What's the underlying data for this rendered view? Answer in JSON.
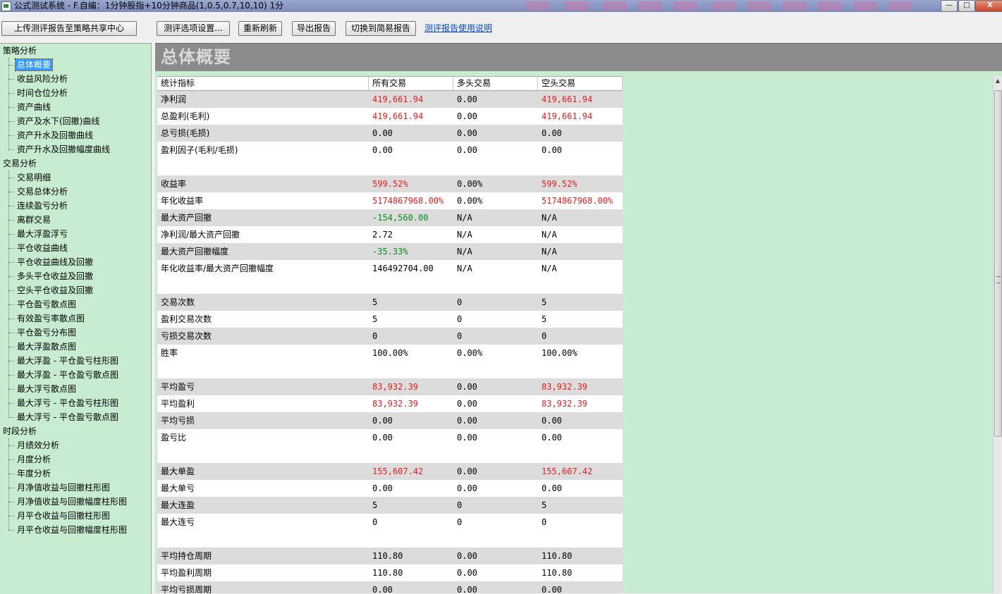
{
  "window": {
    "title": "公式测试系统 - F.自编：1分钟股指+10分钟商品(1,0.5,0.7,10,10) 1分",
    "minimize": "—",
    "maximize": "□",
    "close": "X"
  },
  "toolbar": {
    "upload": "上传测评报告至策略共享中心",
    "options": "测评选项设置...",
    "refresh": "重新刷新",
    "export": "导出报告",
    "simple": "切换到简易报告",
    "help": "测评报告使用说明"
  },
  "tree": {
    "groups": [
      {
        "label": "策略分析",
        "items": [
          "总体概要",
          "收益风险分析",
          "时间仓位分析",
          "资产曲线",
          "资产及水下(回撤)曲线",
          "资产升水及回撤曲线",
          "资产升水及回撤幅度曲线"
        ]
      },
      {
        "label": "交易分析",
        "items": [
          "交易明细",
          "交易总体分析",
          "连续盈亏分析",
          "离群交易",
          "最大浮盈浮亏",
          "平仓收益曲线",
          "平仓收益曲线及回撤",
          "多头平仓收益及回撤",
          "空头平仓收益及回撤",
          "平仓盈亏散点图",
          "有效盈亏率散点图",
          "平仓盈亏分布图",
          "最大浮盈散点图",
          "最大浮盈 - 平仓盈亏柱形图",
          "最大浮盈 - 平仓盈亏散点图",
          "最大浮亏散点图",
          "最大浮亏 - 平仓盈亏柱形图",
          "最大浮亏 - 平仓盈亏散点图"
        ]
      },
      {
        "label": "时段分析",
        "items": [
          "月绩效分析",
          "月度分析",
          "年度分析",
          "月净值收益与回撤柱形图",
          "月净值收益与回撤幅度柱形图",
          "月平仓收益与回撤柱形图",
          "月平仓收益与回撤幅度柱形图"
        ]
      }
    ]
  },
  "section": {
    "title": "总体概要"
  },
  "table": {
    "headers": [
      "统计指标",
      "所有交易",
      "多头交易",
      "空头交易"
    ],
    "rows": [
      {
        "label": "净利润",
        "all": "419,661.94",
        "long": "0.00",
        "short": "419,661.94",
        "ca": "red",
        "cs": "red"
      },
      {
        "label": "总盈利(毛利)",
        "all": "419,661.94",
        "long": "0.00",
        "short": "419,661.94",
        "ca": "red",
        "cs": "red"
      },
      {
        "label": "总亏损(毛损)",
        "all": "0.00",
        "long": "0.00",
        "short": "0.00"
      },
      {
        "label": "盈利因子(毛利/毛损)",
        "all": "0.00",
        "long": "0.00",
        "short": "0.00",
        "tall": true
      },
      {
        "label": "收益率",
        "all": "599.52%",
        "long": "0.00%",
        "short": "599.52%",
        "ca": "red",
        "cs": "red"
      },
      {
        "label": "年化收益率",
        "all": "5174867968.00%",
        "long": "0.00%",
        "short": "5174867968.00%",
        "ca": "red",
        "cs": "red"
      },
      {
        "label": "最大资产回撤",
        "all": "-154,560.00",
        "long": "N/A",
        "short": "N/A",
        "ca": "green"
      },
      {
        "label": "净利润/最大资产回撤",
        "all": "2.72",
        "long": "N/A",
        "short": "N/A"
      },
      {
        "label": "最大资产回撤幅度",
        "all": "-35.33%",
        "long": "N/A",
        "short": "N/A",
        "ca": "green"
      },
      {
        "label": "年化收益率/最大资产回撤幅度",
        "all": "146492704.00",
        "long": "N/A",
        "short": "N/A",
        "tall": true
      },
      {
        "label": "交易次数",
        "all": "5",
        "long": "0",
        "short": "5"
      },
      {
        "label": "盈利交易次数",
        "all": "5",
        "long": "0",
        "short": "5"
      },
      {
        "label": "亏损交易次数",
        "all": "0",
        "long": "0",
        "short": "0"
      },
      {
        "label": "胜率",
        "all": "100.00%",
        "long": "0.00%",
        "short": "100.00%",
        "tall": true
      },
      {
        "label": "平均盈亏",
        "all": "83,932.39",
        "long": "0.00",
        "short": "83,932.39",
        "ca": "red",
        "cs": "red"
      },
      {
        "label": "平均盈利",
        "all": "83,932.39",
        "long": "0.00",
        "short": "83,932.39",
        "ca": "red",
        "cs": "red"
      },
      {
        "label": "平均亏损",
        "all": "0.00",
        "long": "0.00",
        "short": "0.00"
      },
      {
        "label": "盈亏比",
        "all": "0.00",
        "long": "0.00",
        "short": "0.00",
        "tall": true
      },
      {
        "label": "最大单盈",
        "all": "155,607.42",
        "long": "0.00",
        "short": "155,607.42",
        "ca": "red",
        "cs": "red"
      },
      {
        "label": "最大单亏",
        "all": "0.00",
        "long": "0.00",
        "short": "0.00"
      },
      {
        "label": "最大连盈",
        "all": "5",
        "long": "0",
        "short": "5"
      },
      {
        "label": "最大连亏",
        "all": "0",
        "long": "0",
        "short": "0",
        "tall": true
      },
      {
        "label": "平均持仓周期",
        "all": "110.80",
        "long": "0.00",
        "short": "110.80"
      },
      {
        "label": "平均盈利周期",
        "all": "110.80",
        "long": "0.00",
        "short": "110.80"
      },
      {
        "label": "平均亏损周期",
        "all": "0.00",
        "long": "0.00",
        "short": "0.00"
      }
    ]
  }
}
